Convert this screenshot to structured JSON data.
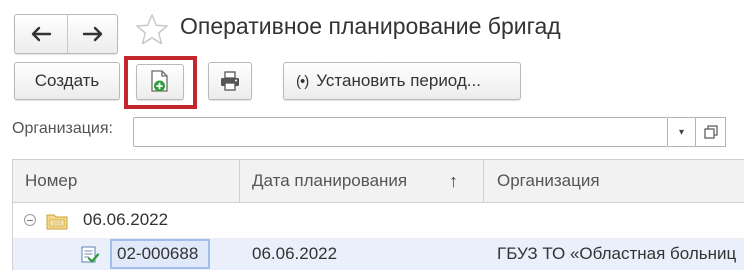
{
  "window": {
    "title": "Оперативное планирование бригад"
  },
  "nav": {
    "back_icon": "arrow-left-icon",
    "forward_icon": "arrow-right-icon",
    "favorite_icon": "star-outline-icon"
  },
  "toolbar": {
    "create_label": "Создать",
    "copy_icon": "copy-document-icon",
    "print_icon": "printer-icon",
    "period_icon": "(•)",
    "period_label": "Установить период..."
  },
  "filter": {
    "organization_label": "Организация:",
    "organization_value": "",
    "dropdown_icon": "▾",
    "open_icon": "open-window-icon"
  },
  "table": {
    "columns": [
      "Номер",
      "Дата планирования",
      "Организация"
    ],
    "sort_arrow": "↑",
    "group": {
      "label": "06.06.2022"
    },
    "rows": [
      {
        "number": "02-000688",
        "date": "06.06.2022",
        "organization": "ГБУЗ ТО «Областная больниц"
      }
    ]
  },
  "colors": {
    "highlight_border": "#c4262e",
    "selected_row": "#eaf0fb",
    "selected_cell_border": "#9ec0ea",
    "header_bg": "#f2f2f2"
  }
}
